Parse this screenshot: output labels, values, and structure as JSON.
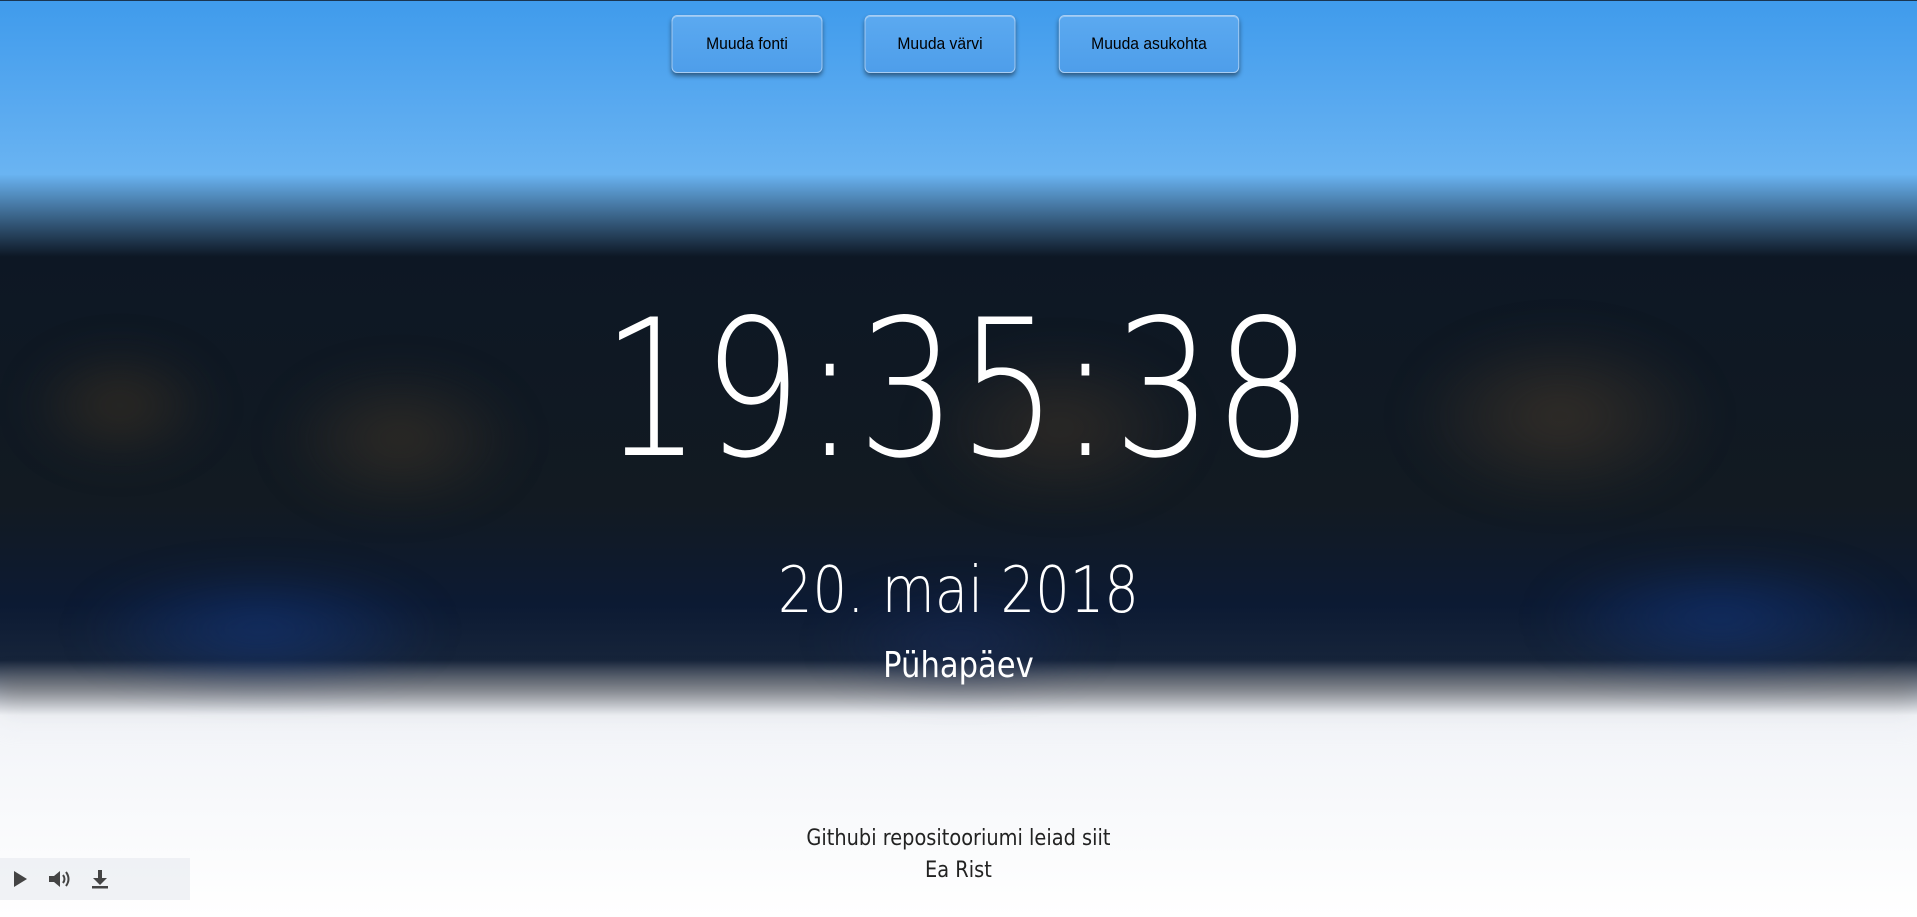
{
  "toolbar": {
    "change_font_label": "Muuda fonti",
    "change_color_label": "Muuda värvi",
    "change_position_label": "Muuda asukohta"
  },
  "clock": {
    "time": "19:35:38",
    "date": "20. mai 2018",
    "weekday": "Pühapäev"
  },
  "footer": {
    "repo_link": "Githubi repositooriumi leiad siit",
    "author": "Ea Rist"
  },
  "audio_player": {
    "controls": [
      "play-icon",
      "volume-icon",
      "download-icon"
    ]
  },
  "colors": {
    "button_bg": "#4e9eea",
    "text_primary": "#ffffff",
    "footer_text": "#222222"
  }
}
